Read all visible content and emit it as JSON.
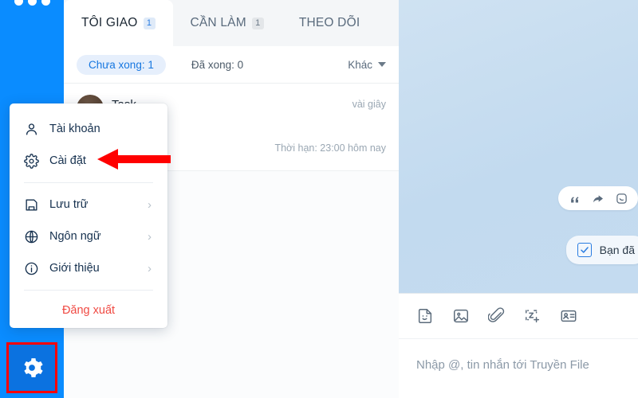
{
  "rail": {
    "dots_icon": "more-dots-icon",
    "gear_icon": "gear-icon",
    "highlight_color": "#ff0000",
    "background_color": "#0a8cff"
  },
  "tabs": [
    {
      "label": "TÔI GIAO",
      "badge": "1",
      "active": true
    },
    {
      "label": "CẦN LÀM",
      "badge": "1",
      "active": false
    },
    {
      "label": "THEO DÕI",
      "badge": "",
      "active": false
    }
  ],
  "filters": {
    "chip": "Chưa xong: 1",
    "plain": "Đã xong: 0",
    "more": "Khác",
    "caret_icon": "chevron-down-icon"
  },
  "task": {
    "title": "Task",
    "time": "vài giây",
    "deadline": "Thời hạn: 23:00 hôm nay",
    "avatar_icon": "avatar"
  },
  "menu": {
    "items": [
      {
        "label": "Tài khoản",
        "icon": "person-icon",
        "chevron": false
      },
      {
        "label": "Cài đặt",
        "icon": "gear-icon",
        "chevron": false
      },
      {
        "label": "Lưu trữ",
        "icon": "save-icon",
        "chevron": true
      },
      {
        "label": "Ngôn ngữ",
        "icon": "globe-icon",
        "chevron": true
      },
      {
        "label": "Giới thiệu",
        "icon": "info-icon",
        "chevron": true
      }
    ],
    "chevron_glyph": "›",
    "logout": "Đăng xuất",
    "logout_color": "#f04a43"
  },
  "annotation": {
    "arrow_icon": "red-arrow-left-icon",
    "arrow_color": "#ff0000"
  },
  "chat": {
    "message_tools": [
      {
        "icon": "quote-icon"
      },
      {
        "icon": "forward-icon"
      },
      {
        "icon": "more-actions-icon"
      }
    ],
    "bubble": {
      "text": "Bạn đã",
      "checkbox_icon": "checkbox-checked-icon",
      "accent": "#2a7de1"
    },
    "composer": {
      "tools": [
        {
          "icon": "sticker-icon"
        },
        {
          "icon": "image-icon"
        },
        {
          "icon": "attachment-icon"
        },
        {
          "icon": "zcapture-icon"
        },
        {
          "icon": "business-card-icon"
        }
      ],
      "placeholder": "Nhập @, tin nhắn tới Truyền File"
    }
  }
}
